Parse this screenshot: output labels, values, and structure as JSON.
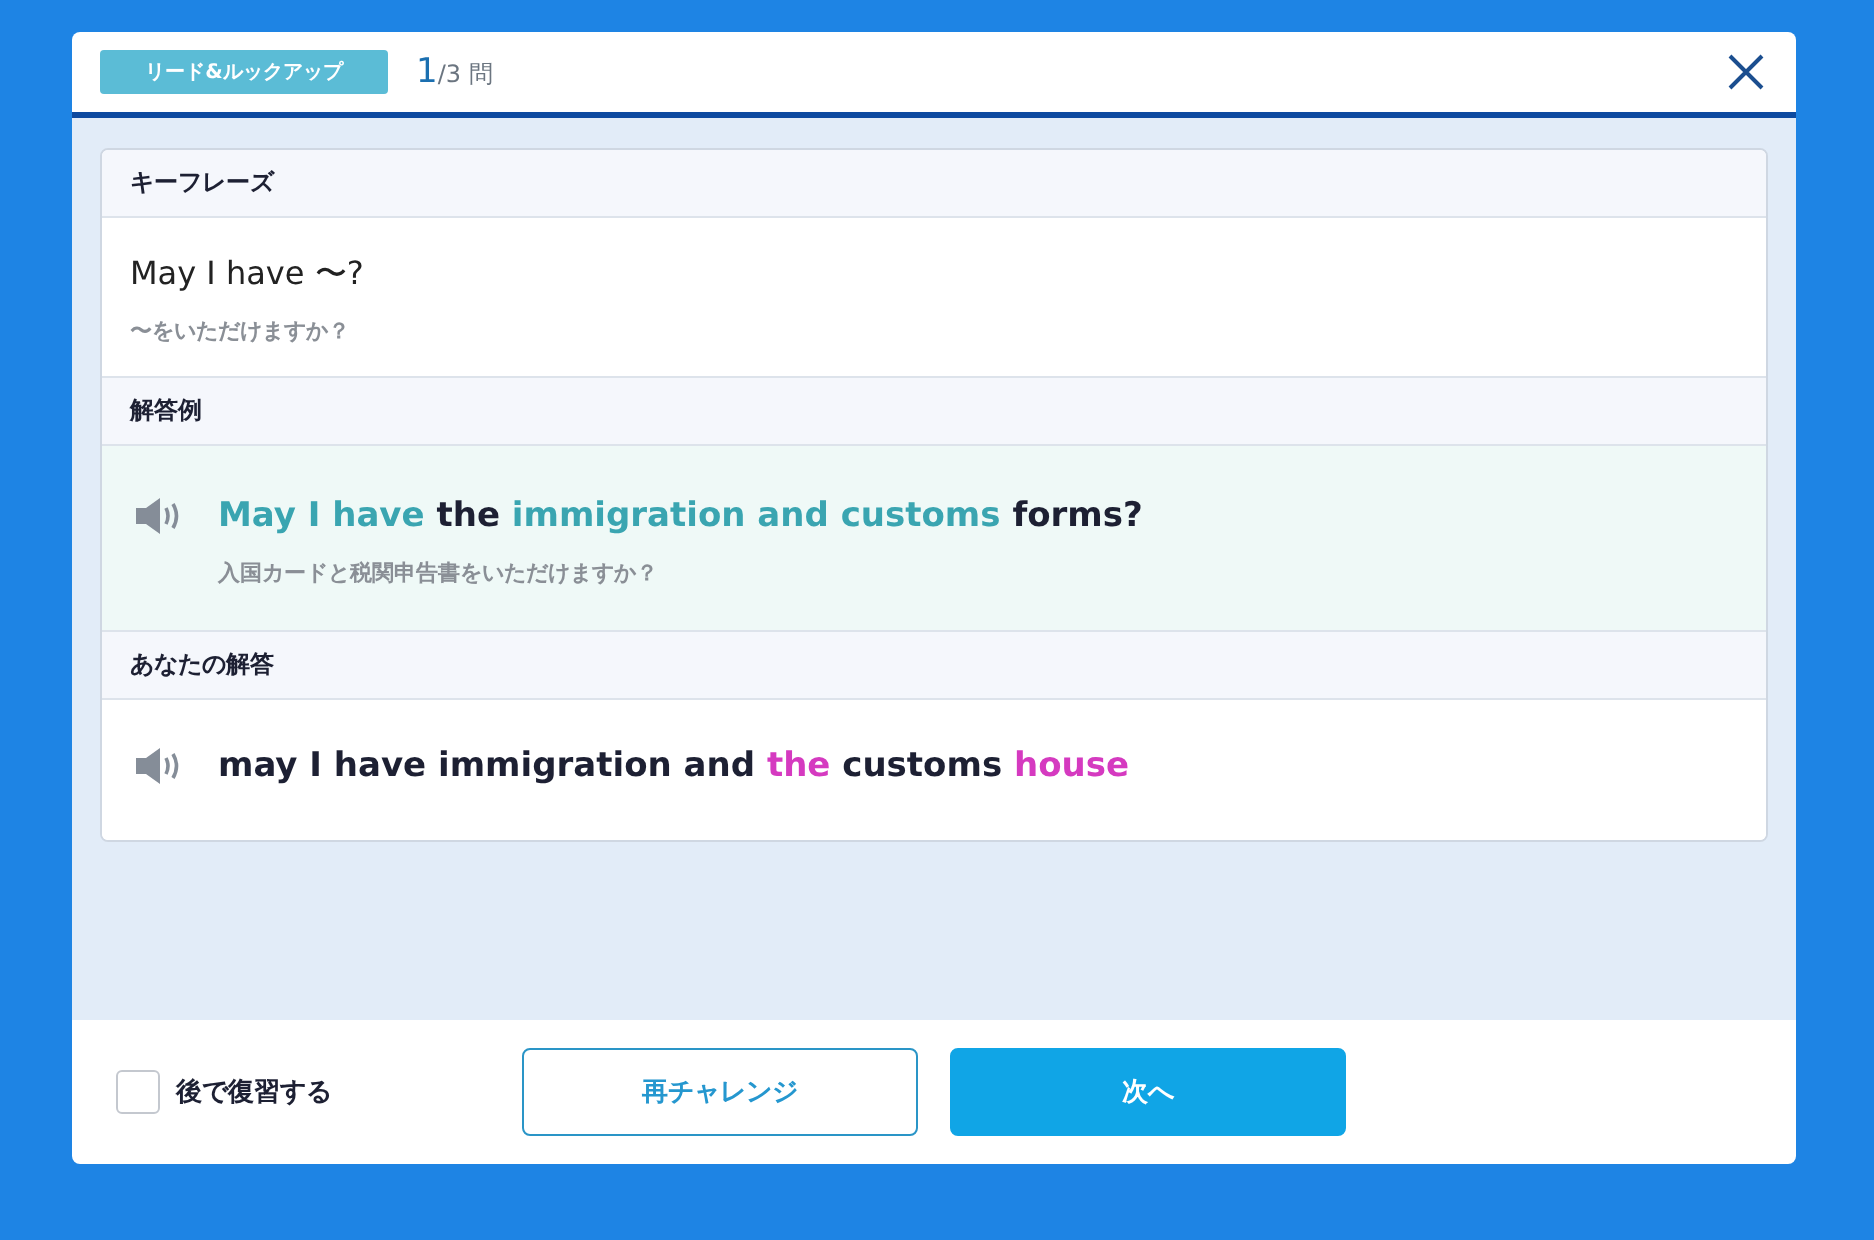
{
  "header": {
    "category": "リード&ルックアップ",
    "progress": {
      "current": "1",
      "total": "/3",
      "unit": "問"
    }
  },
  "sections": [
    {
      "kind": "phrase",
      "title": "キーフレーズ",
      "text": "May I have 〜?",
      "translation": "〜をいただけますか？"
    },
    {
      "kind": "example",
      "title": "解答例",
      "segments": [
        {
          "text": "May I have",
          "kind": "match"
        },
        {
          "text": "the",
          "kind": "plain"
        },
        {
          "text": "immigration and customs",
          "kind": "match"
        },
        {
          "text": "forms?",
          "kind": "plain"
        }
      ],
      "translation": "入国カードと税関申告書をいただけますか？"
    },
    {
      "kind": "answer",
      "title": "あなたの解答",
      "segments": [
        {
          "text": "may I have immigration and",
          "kind": "plain"
        },
        {
          "text": "the",
          "kind": "wrong"
        },
        {
          "text": "customs",
          "kind": "plain"
        },
        {
          "text": "house",
          "kind": "wrong"
        }
      ]
    }
  ],
  "footer": {
    "review": {
      "label": "後で復習する",
      "checked": false
    },
    "buttons": [
      {
        "label": "再チャレンジ",
        "kind": "outline"
      },
      {
        "label": "次へ",
        "kind": "primary"
      }
    ]
  }
}
